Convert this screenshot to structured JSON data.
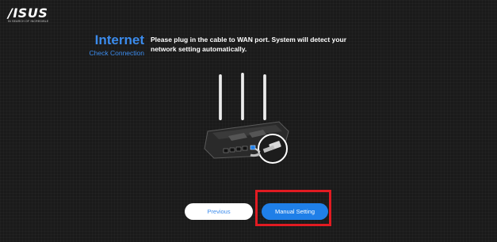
{
  "brand": {
    "logo": "/ISUS",
    "tagline": "IN SEARCH OF INCREDIBLE"
  },
  "page": {
    "title": "Internet",
    "subtitle": "Check Connection",
    "instruction": "Please plug in the cable to WAN port. System will detect your network setting automatically."
  },
  "illustration": {
    "icon": "router-wan-cable-illustration"
  },
  "buttons": {
    "previous": "Previous",
    "manual_setting": "Manual Setting"
  },
  "colors": {
    "accent": "#3b8bec",
    "primary_button": "#1f7fe8",
    "highlight": "#e11b22",
    "background": "#1a1a1a"
  }
}
